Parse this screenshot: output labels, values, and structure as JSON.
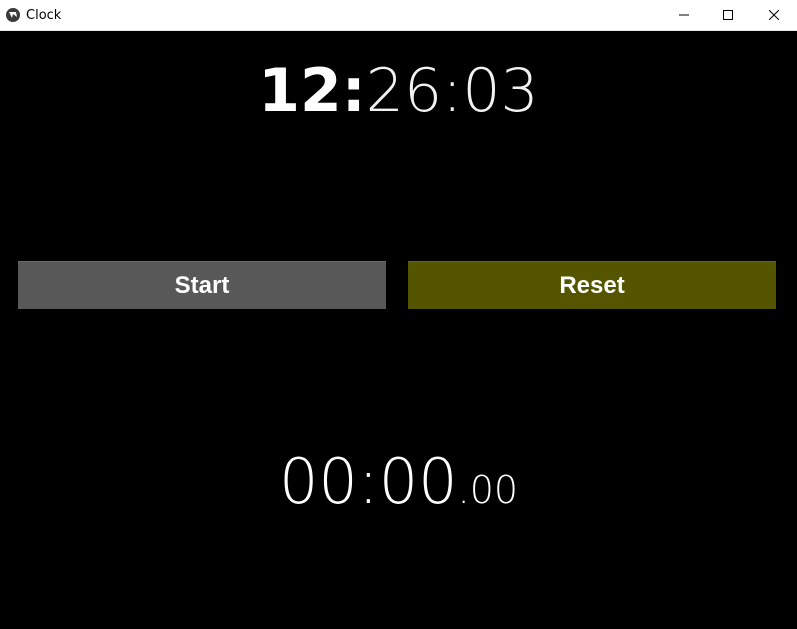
{
  "window": {
    "title": "Clock",
    "controls": {
      "minimize": "minimize-icon",
      "maximize": "maximize-icon",
      "close": "close-icon"
    }
  },
  "clock": {
    "hours": "12:",
    "minutes_seconds": "26:03"
  },
  "buttons": {
    "start_label": "Start",
    "reset_label": "Reset",
    "start_color": "#585858",
    "reset_color": "#555500"
  },
  "stopwatch": {
    "main": "00:00",
    "fraction": ".00"
  },
  "colors": {
    "background": "#000000",
    "text": "#ffffff"
  }
}
